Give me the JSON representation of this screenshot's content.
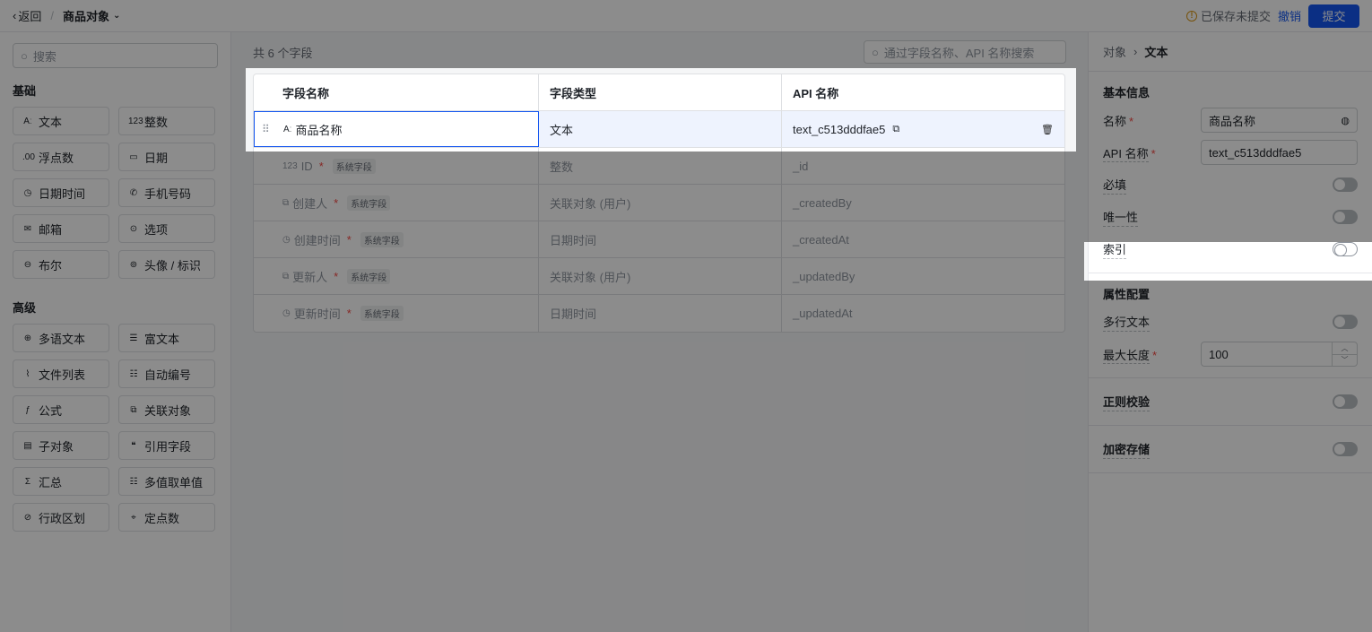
{
  "header": {
    "back_label": "返回",
    "separator": "/",
    "object_title": "商品对象",
    "saved_note": "已保存未提交",
    "undo_label": "撤销",
    "submit_label": "提交"
  },
  "left": {
    "search_placeholder": "搜索",
    "basic_title": "基础",
    "basic_items": [
      {
        "icon": "Aː",
        "label": "文本"
      },
      {
        "icon": "123",
        "label": "整数"
      },
      {
        "icon": ".00",
        "label": "浮点数"
      },
      {
        "icon": "▭",
        "label": "日期"
      },
      {
        "icon": "◷",
        "label": "日期时间"
      },
      {
        "icon": "✆",
        "label": "手机号码"
      },
      {
        "icon": "✉",
        "label": "邮箱"
      },
      {
        "icon": "⊙",
        "label": "选项"
      },
      {
        "icon": "⊖",
        "label": "布尔"
      },
      {
        "icon": "⊚",
        "label": "头像 / 标识"
      }
    ],
    "advanced_title": "高级",
    "advanced_items": [
      {
        "icon": "⊕",
        "label": "多语文本"
      },
      {
        "icon": "☰",
        "label": "富文本"
      },
      {
        "icon": "⌇",
        "label": "文件列表"
      },
      {
        "icon": "☷",
        "label": "自动编号"
      },
      {
        "icon": "ƒ",
        "label": "公式"
      },
      {
        "icon": "⧉",
        "label": "关联对象"
      },
      {
        "icon": "▤",
        "label": "子对象"
      },
      {
        "icon": "❝",
        "label": "引用字段"
      },
      {
        "icon": "Σ",
        "label": "汇总"
      },
      {
        "icon": "☷",
        "label": "多值取单值"
      },
      {
        "icon": "⊘",
        "label": "行政区划"
      },
      {
        "icon": "⌖",
        "label": "定点数"
      }
    ]
  },
  "middle": {
    "count_label": "共 6 个字段",
    "search_placeholder": "通过字段名称、API 名称搜索",
    "columns": [
      "字段名称",
      "字段类型",
      "API 名称"
    ],
    "rows": [
      {
        "icon": "Aː",
        "name": "商品名称",
        "required": "",
        "tag": "",
        "type": "文本",
        "api": "text_c513dddfae5"
      },
      {
        "icon": "123",
        "name": "ID",
        "required": "*",
        "tag": "系统字段",
        "type": "整数",
        "api": "_id"
      },
      {
        "icon": "⧉",
        "name": "创建人",
        "required": "*",
        "tag": "系统字段",
        "type": "关联对象 (用户)",
        "api": "_createdBy"
      },
      {
        "icon": "◷",
        "name": "创建时间",
        "required": "*",
        "tag": "系统字段",
        "type": "日期时间",
        "api": "_createdAt"
      },
      {
        "icon": "⧉",
        "name": "更新人",
        "required": "*",
        "tag": "系统字段",
        "type": "关联对象 (用户)",
        "api": "_updatedBy"
      },
      {
        "icon": "◷",
        "name": "更新时间",
        "required": "*",
        "tag": "系统字段",
        "type": "日期时间",
        "api": "_updatedAt"
      }
    ]
  },
  "right": {
    "breadcrumb_parent": "对象",
    "breadcrumb_current": "文本",
    "basic_info_title": "基本信息",
    "name_label": "名称",
    "name_value": "商品名称",
    "api_label": "API 名称",
    "api_value": "text_c513dddfae5",
    "required_label": "必填",
    "unique_label": "唯一性",
    "index_label": "索引",
    "attr_title": "属性配置",
    "multiline_label": "多行文本",
    "maxlen_label": "最大长度",
    "maxlen_value": "100",
    "regex_label": "正则校验",
    "encrypt_label": "加密存储",
    "required_star": "*"
  }
}
